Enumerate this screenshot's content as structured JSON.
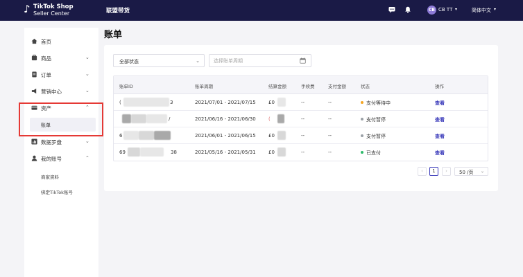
{
  "header": {
    "logo_line1": "TikTok Shop",
    "logo_line2": "Seller Center",
    "nav_title": "联盟带货",
    "user_initials": "CB",
    "user_name": "CB TT",
    "language": "简体中文",
    "icons": [
      "message-icon",
      "bell-icon",
      "chevron-down-icon"
    ],
    "background_color": "#1a1a46"
  },
  "sidebar": {
    "items": [
      {
        "label": "首页",
        "icon": "home-icon"
      },
      {
        "label": "商品",
        "icon": "product-icon"
      },
      {
        "label": "订单",
        "icon": "order-icon"
      },
      {
        "label": "营销中心",
        "icon": "megaphone-icon"
      },
      {
        "label": "资产",
        "icon": "wallet-icon"
      },
      {
        "label": "数据罗盘",
        "icon": "chart-icon"
      },
      {
        "label": "我的账号",
        "icon": "user-icon"
      }
    ],
    "asset_sub_active": "账单",
    "account_subs": [
      "商家资料",
      "绑定TikTok账号"
    ]
  },
  "main": {
    "title": "账单",
    "status_filter": "全部状态",
    "date_placeholder": "选择账单周期",
    "table": {
      "headers": [
        "账单ID",
        "账单周期",
        "结算金额",
        "手续费",
        "支付金额",
        "状态",
        "操作"
      ],
      "rows": [
        {
          "id_prefix": "(",
          "id_suffix": "3",
          "period": "2021/07/01 - 2021/07/15",
          "amount": "£0",
          "fee": "--",
          "paid": "--",
          "status": "支付等待中",
          "status_color": "#f5a623",
          "action": "查看"
        },
        {
          "id_prefix": "",
          "id_suffix": "/",
          "period": "2021/06/16 - 2021/06/30",
          "amount": "(",
          "fee": "--",
          "paid": "--",
          "status": "支付暂停",
          "status_color": "#9aa0a6",
          "action": "查看"
        },
        {
          "id_prefix": "6",
          "id_suffix": "",
          "period": "2021/06/01 - 2021/06/15",
          "amount": "£0",
          "fee": "--",
          "paid": "--",
          "status": "支付暂停",
          "status_color": "#9aa0a6",
          "action": "查看"
        },
        {
          "id_prefix": "69",
          "id_suffix": "38",
          "period": "2021/05/16 - 2021/05/31",
          "amount": "£0",
          "fee": "--",
          "paid": "--",
          "status": "已支付",
          "status_color": "#2dba6a",
          "action": "查看"
        }
      ]
    },
    "pagination": {
      "prev": "‹",
      "current_page": "1",
      "next": "›",
      "page_size": "50 /页"
    }
  },
  "colors": {
    "accent": "#3d3dbb",
    "highlight": "#e53935"
  }
}
